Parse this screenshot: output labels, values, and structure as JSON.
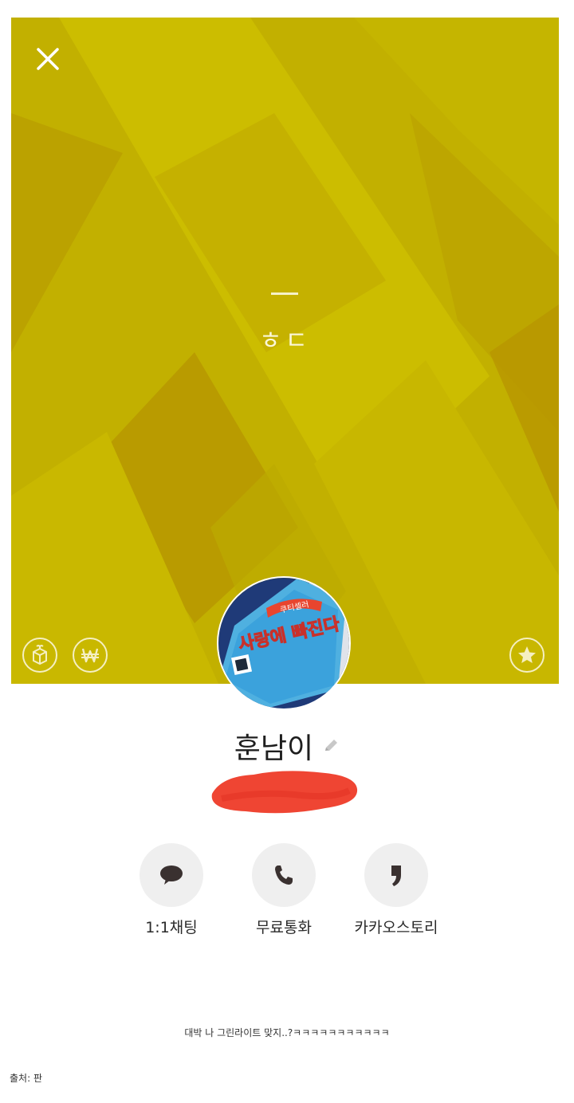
{
  "profile": {
    "status_message": "ㅎㄷ",
    "name": "훈남이"
  },
  "avatar_text": {
    "brand": "쿠티셀러",
    "title": "사랑에 빠진다"
  },
  "actions": [
    {
      "label": "1:1채팅",
      "icon": "chat-bubble-icon"
    },
    {
      "label": "무료통화",
      "icon": "phone-icon"
    },
    {
      "label": "카카오스토리",
      "icon": "kakaostory-icon"
    }
  ],
  "post": {
    "caption": "대박 나 그린라이트 맞지..?ㅋㅋㅋㅋㅋㅋㅋㅋㅋㅋㅋ",
    "source": "출처: 판"
  },
  "colors": {
    "cover_base": "#c3b200",
    "cover_light": "#d1c400",
    "cover_dark": "#bb9e00",
    "redaction": "#ef4533",
    "button_bg": "#efefef",
    "icon_dark": "#3a3130"
  }
}
